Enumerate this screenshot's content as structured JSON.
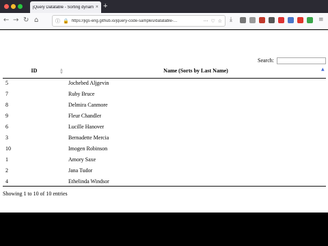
{
  "browser": {
    "tab_title": "jQuery Datatable - Sorting dynamic",
    "tab_close": "×",
    "new_tab": "+",
    "url": "https://jigs-eng.github.io/jquery-code-samples/datatable-…",
    "back_glyph": "←",
    "forward_glyph": "→",
    "reload_glyph": "↻",
    "home_glyph": "⌂"
  },
  "page": {
    "search_label": "Search:",
    "search_value": "",
    "columns": [
      "ID",
      "Name (Sorts by Last Name)"
    ],
    "rows": [
      {
        "id": "5",
        "name": "Jochebed Aljgevin"
      },
      {
        "id": "7",
        "name": "Ruby Bruce"
      },
      {
        "id": "8",
        "name": "Delmira Canmore"
      },
      {
        "id": "9",
        "name": "Fleur Chandler"
      },
      {
        "id": "6",
        "name": "Lucille Hanover"
      },
      {
        "id": "3",
        "name": "Bernadette Mercia"
      },
      {
        "id": "10",
        "name": "Imogen Robinson"
      },
      {
        "id": "1",
        "name": "Amory Saxe"
      },
      {
        "id": "2",
        "name": "Jana Tudor"
      },
      {
        "id": "4",
        "name": "Ethelinda Windsor"
      }
    ],
    "info": "Showing 1 to 10 of 10 entries"
  },
  "colors": {
    "close": "#ff5f57",
    "minimize": "#febc2e",
    "maximize": "#28c840",
    "sort_active": "#4a6fd6"
  }
}
